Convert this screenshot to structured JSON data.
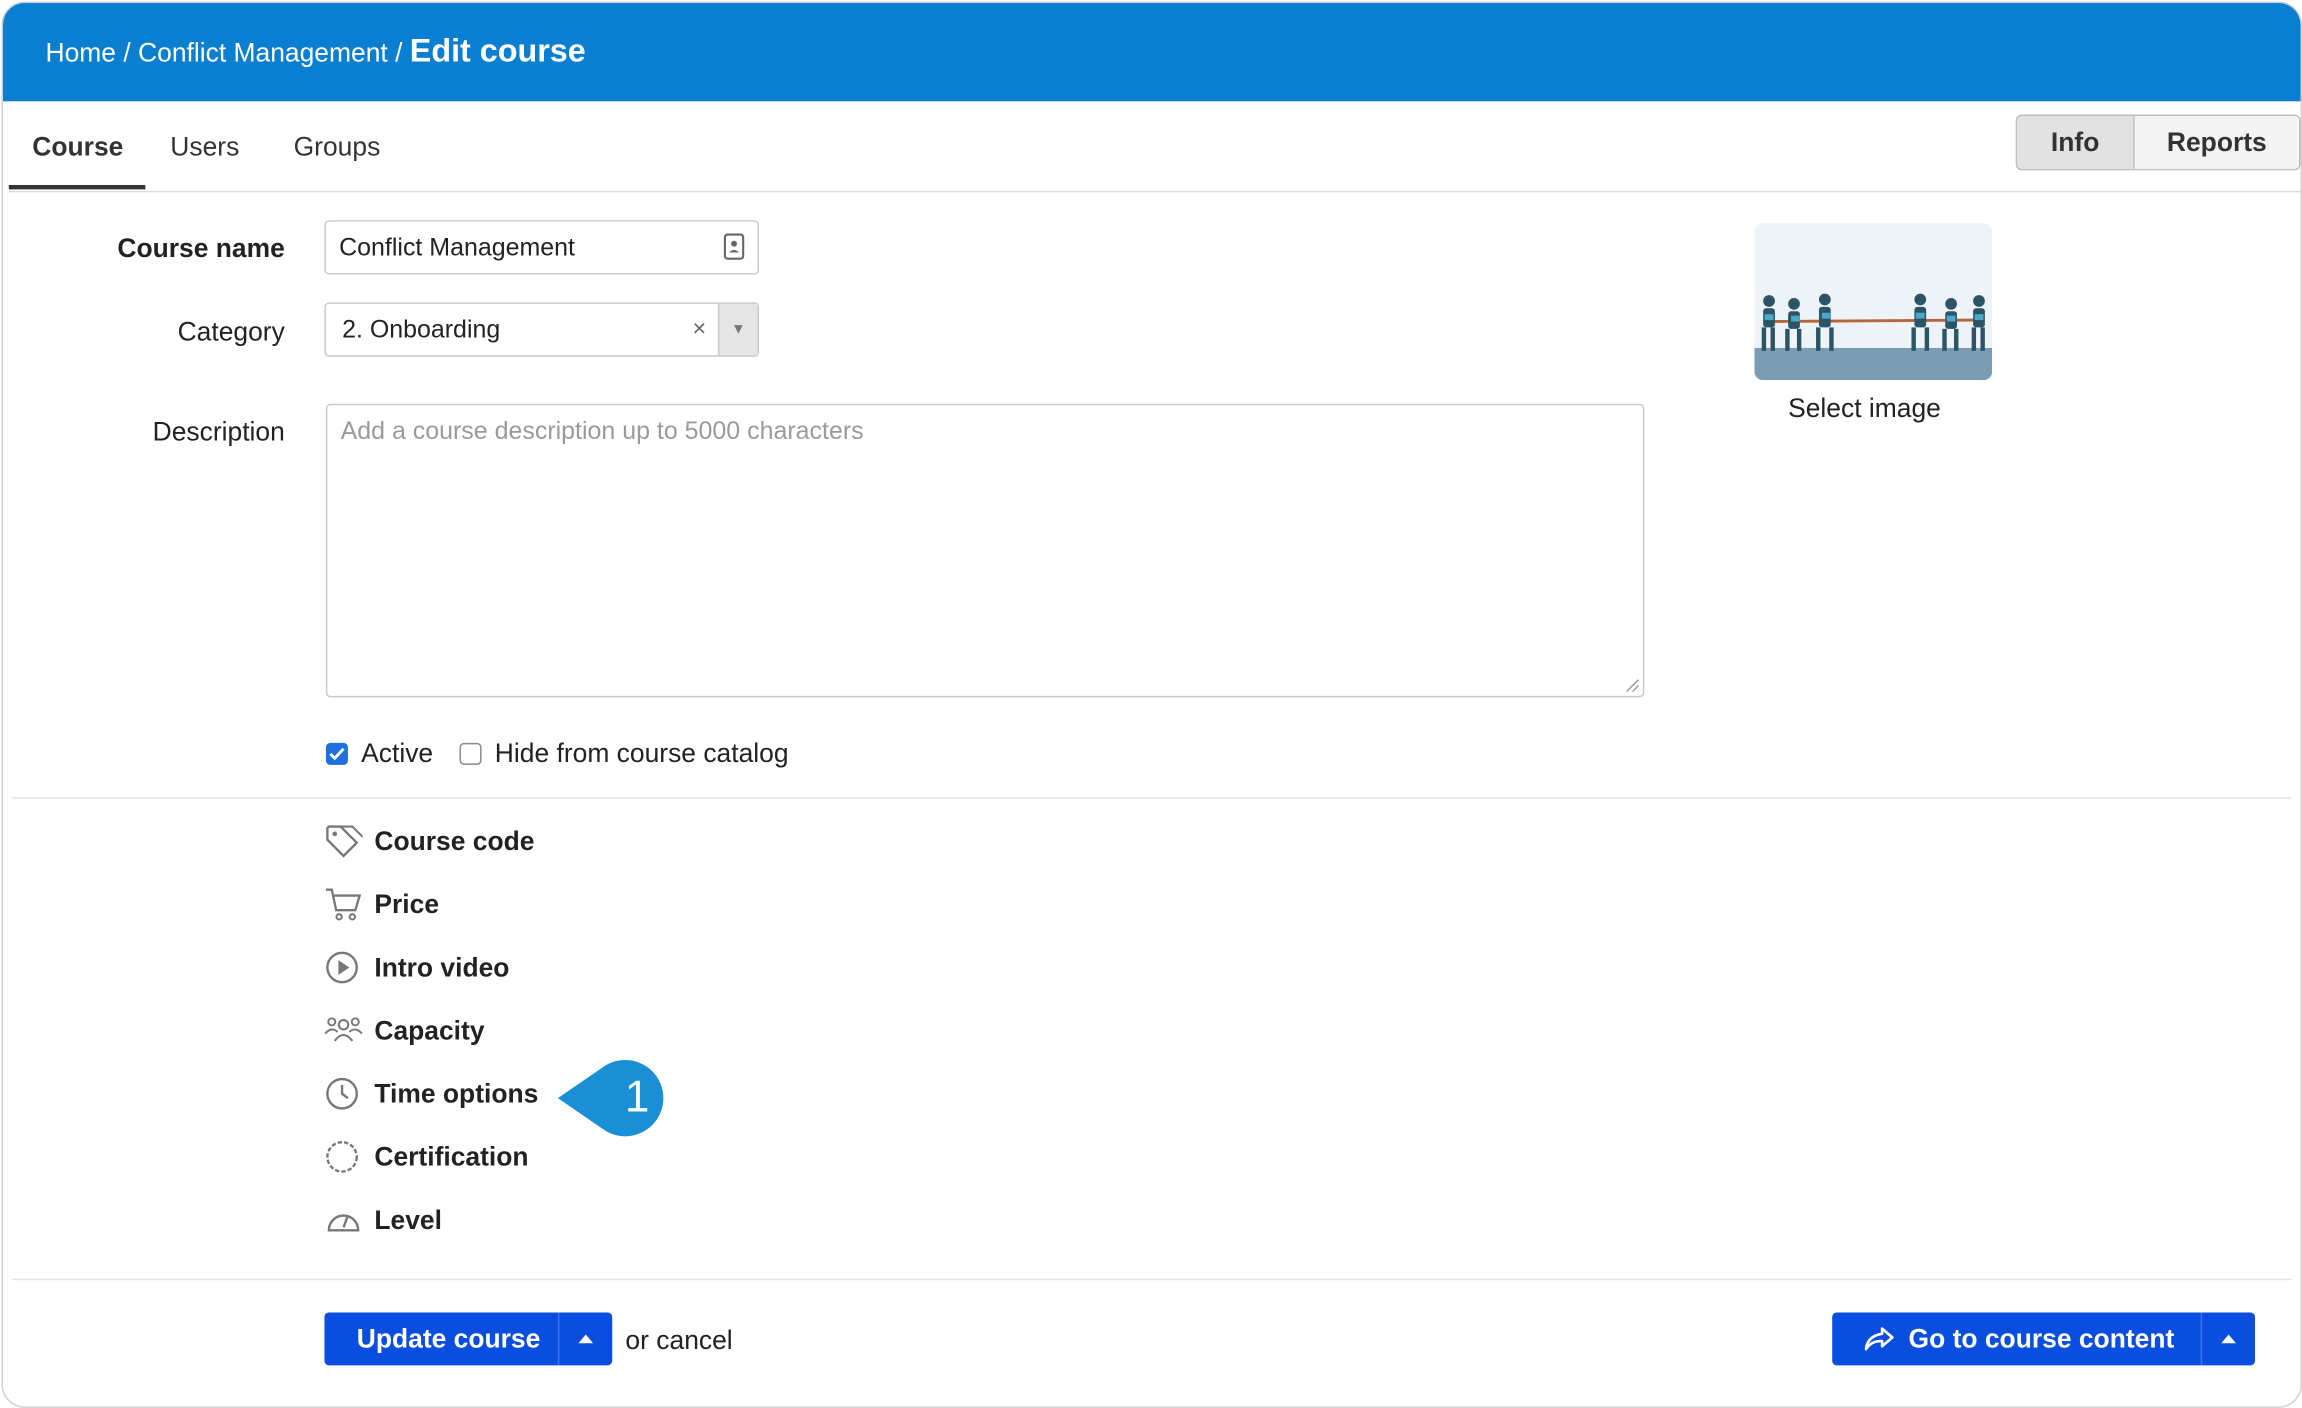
{
  "breadcrumb": {
    "home": "Home",
    "course": "Conflict Management",
    "current": "Edit course",
    "sep": "/"
  },
  "tabs": {
    "course": "Course",
    "users": "Users",
    "groups": "Groups"
  },
  "segment": {
    "info": "Info",
    "reports": "Reports"
  },
  "form": {
    "course_name_label": "Course name",
    "course_name_value": "Conflict Management",
    "category_label": "Category",
    "category_value": "2. Onboarding",
    "category_clear": "×",
    "description_label": "Description",
    "description_placeholder": "Add a course description up to 5000 characters",
    "active_label": "Active",
    "active_checked": true,
    "hide_label": "Hide from course catalog",
    "hide_checked": false
  },
  "image": {
    "caption": "Select image"
  },
  "options": [
    {
      "label": "Course code",
      "icon": "tag-icon"
    },
    {
      "label": "Price",
      "icon": "cart-icon"
    },
    {
      "label": "Intro video",
      "icon": "play-icon"
    },
    {
      "label": "Capacity",
      "icon": "people-icon"
    },
    {
      "label": "Time options",
      "icon": "clock-icon"
    },
    {
      "label": "Certification",
      "icon": "badge-icon"
    },
    {
      "label": "Level",
      "icon": "gauge-icon"
    }
  ],
  "callout": {
    "number": "1",
    "color": "#1a8fd6"
  },
  "footer": {
    "update_label": "Update course",
    "or_text": "or",
    "cancel_text": "cancel",
    "go_label": "Go to course content"
  },
  "colors": {
    "header": "#0a7fd1",
    "primary_button": "#0a4ee0",
    "checkbox": "#1e6fe0"
  }
}
